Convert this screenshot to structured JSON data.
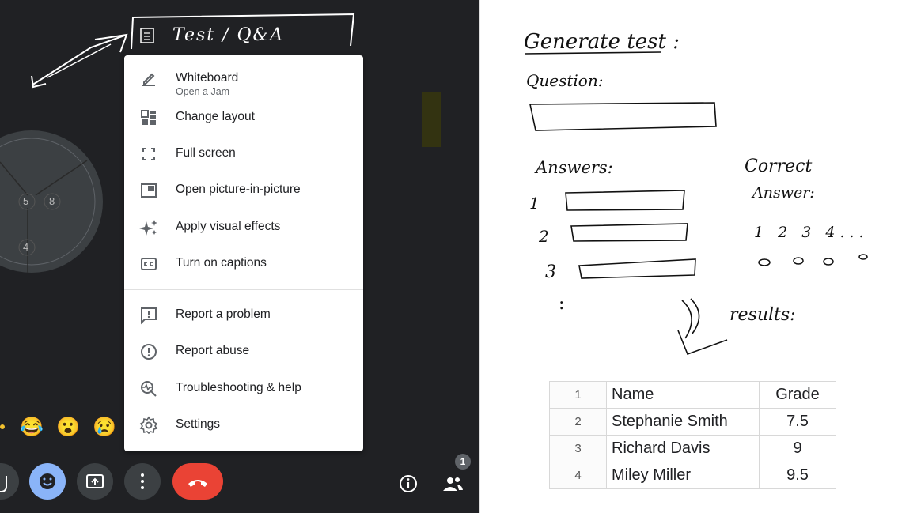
{
  "handwritten_header": "Test / Q&A",
  "menu": {
    "items": [
      {
        "label": "Whiteboard",
        "sublabel": "Open a Jam"
      },
      {
        "label": "Change layout"
      },
      {
        "label": "Full screen"
      },
      {
        "label": "Open picture-in-picture"
      },
      {
        "label": "Apply visual effects"
      },
      {
        "label": "Turn on captions"
      },
      {
        "label": "Report a problem"
      },
      {
        "label": "Report abuse"
      },
      {
        "label": "Troubleshooting & help"
      },
      {
        "label": "Settings"
      }
    ]
  },
  "tile_numbers": [
    "5",
    "8",
    "4"
  ],
  "reactions": [
    "😂",
    "😮",
    "😢"
  ],
  "controls": {
    "participants_badge": "1",
    "end_call_color": "#ea4335",
    "emoji_button_color": "#8ab4f8"
  },
  "sketch": {
    "title": "Generate test :",
    "question_label": "Question:",
    "answers_label": "Answers:",
    "answer_numbers": [
      "1",
      "2",
      "3"
    ],
    "ellipsis": ":",
    "correct_label_line1": "Correct",
    "correct_label_line2": "Answer:",
    "correct_options": "1 2 3 4...",
    "results_label": "results:"
  },
  "sheet": {
    "rows": [
      {
        "row": "1",
        "name": "Name",
        "grade": "Grade"
      },
      {
        "row": "2",
        "name": "Stephanie Smith",
        "grade": "7.5"
      },
      {
        "row": "3",
        "name": "Richard Davis",
        "grade": "9"
      },
      {
        "row": "4",
        "name": "Miley Miller",
        "grade": "9.5"
      }
    ]
  }
}
